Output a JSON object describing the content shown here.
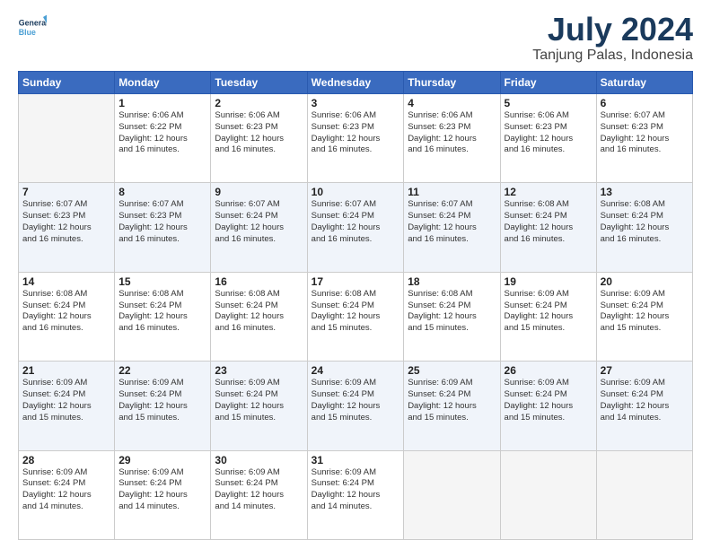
{
  "logo": {
    "line1": "General",
    "line2": "Blue"
  },
  "title": "July 2024",
  "subtitle": "Tanjung Palas, Indonesia",
  "days_header": [
    "Sunday",
    "Monday",
    "Tuesday",
    "Wednesday",
    "Thursday",
    "Friday",
    "Saturday"
  ],
  "weeks": [
    [
      {
        "day": "",
        "info": ""
      },
      {
        "day": "1",
        "info": "Sunrise: 6:06 AM\nSunset: 6:22 PM\nDaylight: 12 hours\nand 16 minutes."
      },
      {
        "day": "2",
        "info": "Sunrise: 6:06 AM\nSunset: 6:23 PM\nDaylight: 12 hours\nand 16 minutes."
      },
      {
        "day": "3",
        "info": "Sunrise: 6:06 AM\nSunset: 6:23 PM\nDaylight: 12 hours\nand 16 minutes."
      },
      {
        "day": "4",
        "info": "Sunrise: 6:06 AM\nSunset: 6:23 PM\nDaylight: 12 hours\nand 16 minutes."
      },
      {
        "day": "5",
        "info": "Sunrise: 6:06 AM\nSunset: 6:23 PM\nDaylight: 12 hours\nand 16 minutes."
      },
      {
        "day": "6",
        "info": "Sunrise: 6:07 AM\nSunset: 6:23 PM\nDaylight: 12 hours\nand 16 minutes."
      }
    ],
    [
      {
        "day": "7",
        "info": "Sunrise: 6:07 AM\nSunset: 6:23 PM\nDaylight: 12 hours\nand 16 minutes."
      },
      {
        "day": "8",
        "info": "Sunrise: 6:07 AM\nSunset: 6:23 PM\nDaylight: 12 hours\nand 16 minutes."
      },
      {
        "day": "9",
        "info": "Sunrise: 6:07 AM\nSunset: 6:24 PM\nDaylight: 12 hours\nand 16 minutes."
      },
      {
        "day": "10",
        "info": "Sunrise: 6:07 AM\nSunset: 6:24 PM\nDaylight: 12 hours\nand 16 minutes."
      },
      {
        "day": "11",
        "info": "Sunrise: 6:07 AM\nSunset: 6:24 PM\nDaylight: 12 hours\nand 16 minutes."
      },
      {
        "day": "12",
        "info": "Sunrise: 6:08 AM\nSunset: 6:24 PM\nDaylight: 12 hours\nand 16 minutes."
      },
      {
        "day": "13",
        "info": "Sunrise: 6:08 AM\nSunset: 6:24 PM\nDaylight: 12 hours\nand 16 minutes."
      }
    ],
    [
      {
        "day": "14",
        "info": "Sunrise: 6:08 AM\nSunset: 6:24 PM\nDaylight: 12 hours\nand 16 minutes."
      },
      {
        "day": "15",
        "info": "Sunrise: 6:08 AM\nSunset: 6:24 PM\nDaylight: 12 hours\nand 16 minutes."
      },
      {
        "day": "16",
        "info": "Sunrise: 6:08 AM\nSunset: 6:24 PM\nDaylight: 12 hours\nand 16 minutes."
      },
      {
        "day": "17",
        "info": "Sunrise: 6:08 AM\nSunset: 6:24 PM\nDaylight: 12 hours\nand 15 minutes."
      },
      {
        "day": "18",
        "info": "Sunrise: 6:08 AM\nSunset: 6:24 PM\nDaylight: 12 hours\nand 15 minutes."
      },
      {
        "day": "19",
        "info": "Sunrise: 6:09 AM\nSunset: 6:24 PM\nDaylight: 12 hours\nand 15 minutes."
      },
      {
        "day": "20",
        "info": "Sunrise: 6:09 AM\nSunset: 6:24 PM\nDaylight: 12 hours\nand 15 minutes."
      }
    ],
    [
      {
        "day": "21",
        "info": "Sunrise: 6:09 AM\nSunset: 6:24 PM\nDaylight: 12 hours\nand 15 minutes."
      },
      {
        "day": "22",
        "info": "Sunrise: 6:09 AM\nSunset: 6:24 PM\nDaylight: 12 hours\nand 15 minutes."
      },
      {
        "day": "23",
        "info": "Sunrise: 6:09 AM\nSunset: 6:24 PM\nDaylight: 12 hours\nand 15 minutes."
      },
      {
        "day": "24",
        "info": "Sunrise: 6:09 AM\nSunset: 6:24 PM\nDaylight: 12 hours\nand 15 minutes."
      },
      {
        "day": "25",
        "info": "Sunrise: 6:09 AM\nSunset: 6:24 PM\nDaylight: 12 hours\nand 15 minutes."
      },
      {
        "day": "26",
        "info": "Sunrise: 6:09 AM\nSunset: 6:24 PM\nDaylight: 12 hours\nand 15 minutes."
      },
      {
        "day": "27",
        "info": "Sunrise: 6:09 AM\nSunset: 6:24 PM\nDaylight: 12 hours\nand 14 minutes."
      }
    ],
    [
      {
        "day": "28",
        "info": "Sunrise: 6:09 AM\nSunset: 6:24 PM\nDaylight: 12 hours\nand 14 minutes."
      },
      {
        "day": "29",
        "info": "Sunrise: 6:09 AM\nSunset: 6:24 PM\nDaylight: 12 hours\nand 14 minutes."
      },
      {
        "day": "30",
        "info": "Sunrise: 6:09 AM\nSunset: 6:24 PM\nDaylight: 12 hours\nand 14 minutes."
      },
      {
        "day": "31",
        "info": "Sunrise: 6:09 AM\nSunset: 6:24 PM\nDaylight: 12 hours\nand 14 minutes."
      },
      {
        "day": "",
        "info": ""
      },
      {
        "day": "",
        "info": ""
      },
      {
        "day": "",
        "info": ""
      }
    ]
  ]
}
